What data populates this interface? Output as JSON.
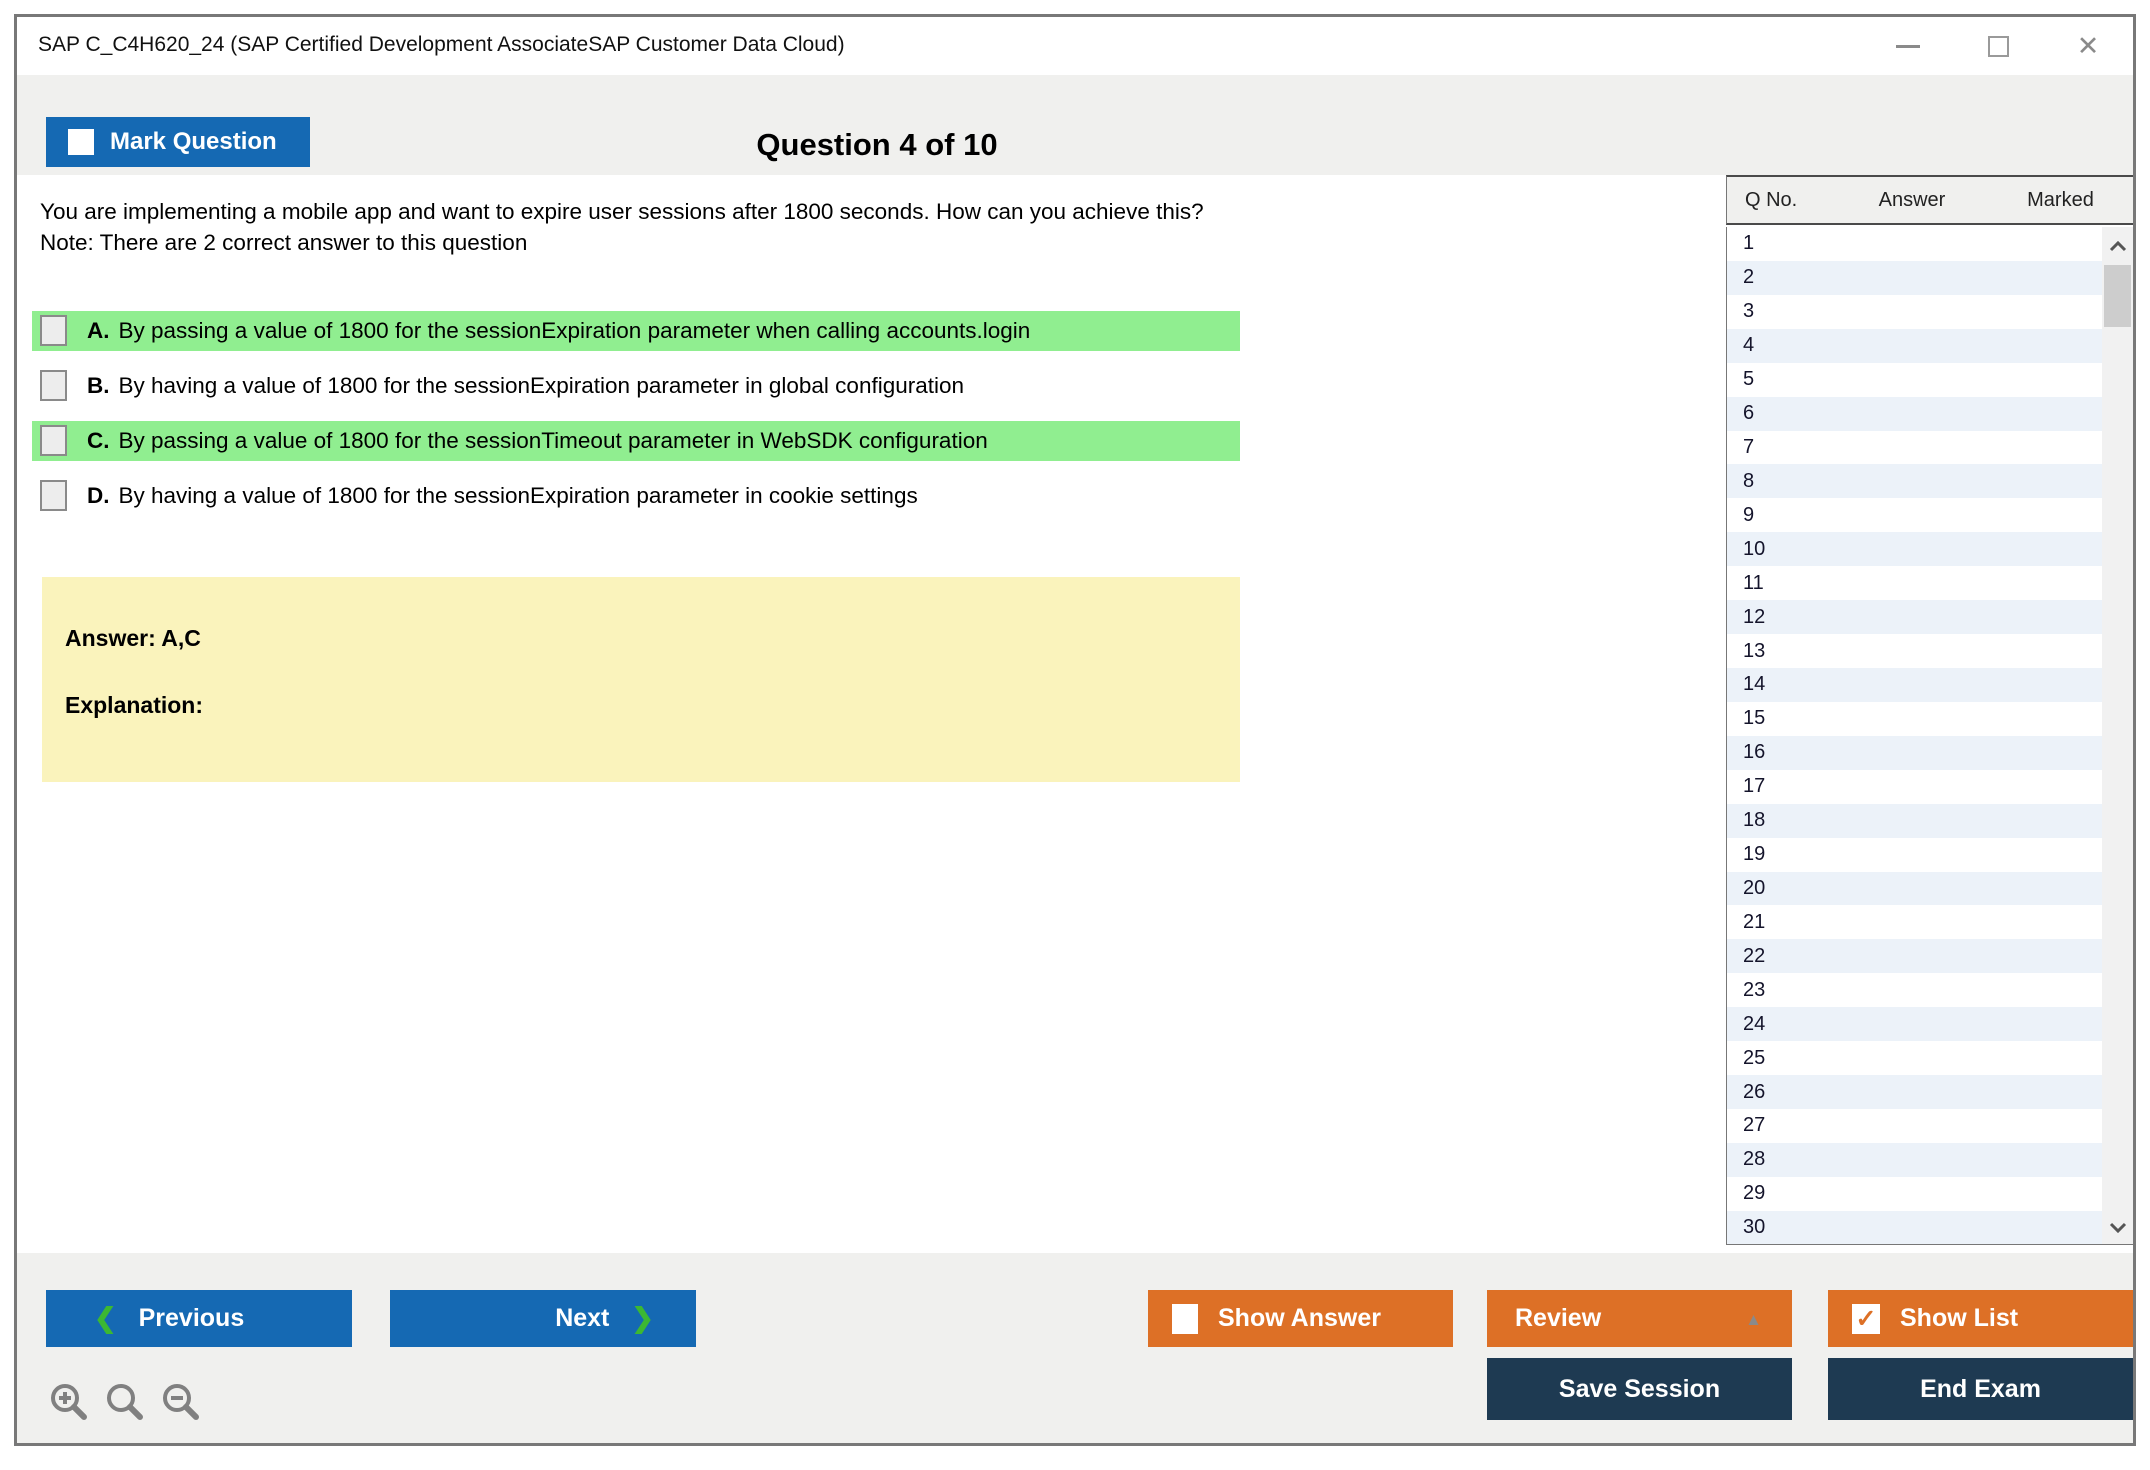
{
  "window": {
    "title": "SAP C_C4H620_24 (SAP Certified Development AssociateSAP Customer Data Cloud)",
    "controls": {
      "minimize": "minimize-icon",
      "maximize": "maximize-icon",
      "close": "close-icon"
    }
  },
  "header": {
    "mark_question_label": "Mark Question",
    "question_counter": "Question 4 of 10"
  },
  "question": {
    "text": "You are implementing a mobile app and want to expire user sessions after 1800 seconds. How can you achieve this? Note: There are 2 correct answer to this question",
    "options": [
      {
        "letter": "A.",
        "text": "By passing a value of 1800 for the sessionExpiration parameter when calling accounts.login",
        "highlighted": true,
        "checked": false
      },
      {
        "letter": "B.",
        "text": "By having a value of 1800 for the sessionExpiration parameter in global configuration",
        "highlighted": false,
        "checked": false
      },
      {
        "letter": "C.",
        "text": "By passing a value of 1800 for the sessionTimeout parameter in WebSDK configuration",
        "highlighted": true,
        "checked": false
      },
      {
        "letter": "D.",
        "text": "By having a value of 1800 for the sessionExpiration parameter in cookie settings",
        "highlighted": false,
        "checked": false
      }
    ],
    "answer_label": "Answer: A,C",
    "explanation_label": "Explanation:"
  },
  "sidebar": {
    "columns": {
      "qno": "Q No.",
      "answer": "Answer",
      "marked": "Marked"
    },
    "row_numbers": [
      "1",
      "2",
      "3",
      "4",
      "5",
      "6",
      "7",
      "8",
      "9",
      "10",
      "11",
      "12",
      "13",
      "14",
      "15",
      "16",
      "17",
      "18",
      "19",
      "20",
      "21",
      "22",
      "23",
      "24",
      "25",
      "26",
      "27",
      "28",
      "29",
      "30"
    ],
    "answers": [
      "",
      "",
      "",
      "",
      "",
      "",
      "",
      "",
      "",
      "",
      "",
      "",
      "",
      "",
      "",
      "",
      "",
      "",
      "",
      "",
      "",
      "",
      "",
      "",
      "",
      "",
      "",
      "",
      "",
      ""
    ],
    "marked": [
      "",
      "",
      "",
      "",
      "",
      "",
      "",
      "",
      "",
      "",
      "",
      "",
      "",
      "",
      "",
      "",
      "",
      "",
      "",
      "",
      "",
      "",
      "",
      "",
      "",
      "",
      "",
      "",
      "",
      ""
    ]
  },
  "footer": {
    "previous_label": "Previous",
    "next_label": "Next",
    "show_answer_label": "Show Answer",
    "review_label": "Review",
    "show_list_label": "Show List",
    "save_session_label": "Save Session",
    "end_exam_label": "End Exam",
    "show_answer_checked": false,
    "show_list_checked": true
  },
  "icons": {
    "check_glyph": "✓",
    "close_glyph": "✕",
    "review_triangle": "▲",
    "chevron_left": "❮",
    "chevron_right": "❯",
    "zoom_in": "zoom-in-icon",
    "magnifier": "magnifier-icon",
    "zoom_out": "zoom-out-icon"
  },
  "colors": {
    "blue": "#1569B3",
    "orange": "#DD7026",
    "navy": "#1E3A52",
    "green_highlight": "#90EE90",
    "yellow_box": "#FAF3BC",
    "chrome_gray": "#F0F0EE",
    "row_stripe": "#ECF2F9",
    "chevron_green": "#3CB832"
  }
}
